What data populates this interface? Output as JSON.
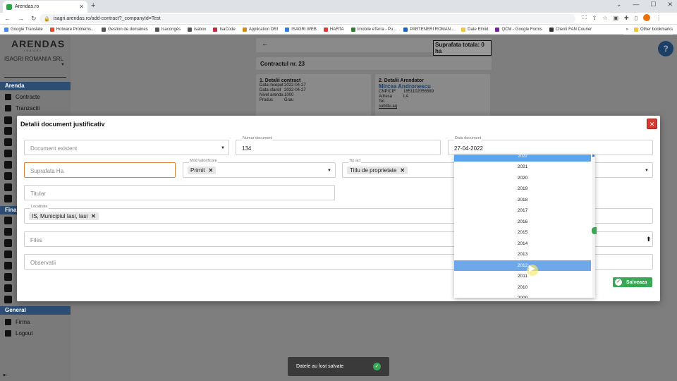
{
  "browser": {
    "tab_title": "Arendas.ro",
    "url": "isagri.arendas.ro/add-contract?_companyId=Test",
    "bookmarks": [
      "Google Translate",
      "Hotware Problems...",
      "Gestion de domaines",
      "Isacongès",
      "isabox",
      "IsaCode",
      "Application DRI",
      "ISAGRI WEB",
      "HARTA",
      "Imobile eTerra - Pu...",
      "PARTENERI ROMAN...",
      "Date Elmid",
      "QCM - Google Forms",
      "Clienti FAN Courier"
    ],
    "other_bookmarks": "Other bookmarks"
  },
  "sidebar": {
    "logo": "ARENDAS",
    "logo_sub": "ISAGRI",
    "company": "ISAGRI ROMANIA SRL",
    "section_arenda": "Arenda",
    "items_arenda": [
      "Contracte",
      "Tranzactii"
    ],
    "section_finance": "Fina",
    "section_general": "General",
    "items_general": [
      "Firma",
      "Logout"
    ]
  },
  "background": {
    "suprafata_totala": "Suprafata totala: 0 ha",
    "contract_title": "Contractul nr. 23",
    "detalii_contract": {
      "title": "1. Detalii contract",
      "rows": [
        [
          "Data inceput",
          "2022-04-27"
        ],
        [
          "Data sfarsit",
          "2032-04-27"
        ],
        [
          "Nivel arenda",
          "1000"
        ],
        [
          "Produs",
          "Grau"
        ]
      ]
    },
    "detalii_arendator": {
      "title": "2. Detalii Arendator",
      "name": "Mircea Andronescu",
      "rows": [
        [
          "CNP/CIF",
          "1851102056589"
        ],
        [
          "Adresa",
          "LA"
        ],
        [
          "Tel.",
          ""
        ]
      ],
      "link": "subtitu.aq"
    }
  },
  "modal": {
    "title": "Detalii document justificativ",
    "fields": {
      "document_existent_placeholder": "Document existent",
      "numar_document_label": "Numar document",
      "numar_document_value": "134",
      "data_document_label": "Data document",
      "data_document_value": "27-04-2022",
      "suprafata_placeholder": "Suprafata Ha",
      "mod_valorificare_label": "Mod valorificare",
      "mod_valorificare_value": "Primit",
      "tip_act_label": "Tip act",
      "tip_act_value": "Titlu de proprietate",
      "titular_placeholder": "Titular",
      "localitate_label": "Localitate",
      "localitate_value": "IS, Municipiul Iasi, Iasi",
      "files_placeholder": "Files",
      "observatii_placeholder": "Observatii"
    },
    "save_label": "Salveaza"
  },
  "year_picker": {
    "years_visible": [
      "2022",
      "2021",
      "2020",
      "2019",
      "2018",
      "2017",
      "2016",
      "2015",
      "2014",
      "2013",
      "2012",
      "2011",
      "2010",
      "2009"
    ],
    "highlighted_year": "2012"
  },
  "toast": {
    "message": "Datele au fost salvate"
  },
  "colors": {
    "primary_navy": "#2c4e75",
    "danger": "#d43a2f",
    "success": "#3aa757",
    "selected_year": "#6ea8e8"
  }
}
